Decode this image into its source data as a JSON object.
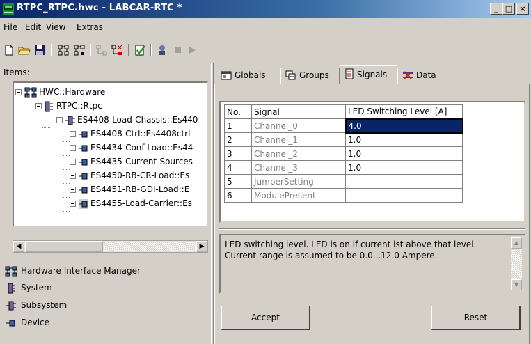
{
  "window": {
    "title": "RTPC_RTPC.hwc - LABCAR-RTC  *"
  },
  "menu": [
    "File",
    "Edit",
    "View",
    "Extras"
  ],
  "toolbar_icons": [
    "new-icon",
    "open-icon",
    "save-icon",
    "tree-a-icon",
    "tree-b-icon",
    "tree-c-icon",
    "tree-d-icon",
    "check-icon",
    "connect-icon",
    "stop-icon",
    "play-icon"
  ],
  "items_label": "Items:",
  "tree": [
    {
      "label": "HWC::Hardware"
    },
    {
      "label": "RTPC::Rtpc"
    },
    {
      "label": "ES4408-Load-Chassis::Es440"
    },
    {
      "label": "ES4408-Ctrl::Es4408ctrl"
    },
    {
      "label": "ES4434-Conf-Load::Es44"
    },
    {
      "label": "ES4435-Current-Sources"
    },
    {
      "label": "ES4450-RB-CR-Load::Es"
    },
    {
      "label": "ES4451-RB-GDI-Load::E"
    },
    {
      "label": "ES4455-Load-Carrier::Es"
    }
  ],
  "legend": [
    {
      "label": "Hardware Interface Manager",
      "icon": "hardware-interface-manager-icon"
    },
    {
      "label": "System",
      "icon": "system-icon"
    },
    {
      "label": "Subsystem",
      "icon": "subsystem-icon"
    },
    {
      "label": "Device",
      "icon": "device-icon"
    }
  ],
  "tabs": [
    {
      "label": "Globals"
    },
    {
      "label": "Groups"
    },
    {
      "label": "Signals",
      "active": true
    },
    {
      "label": "Data"
    }
  ],
  "grid": {
    "headers": {
      "no": "No.",
      "signal": "Signal",
      "level": "LED Switching Level [A]"
    },
    "rows": [
      {
        "no": "1",
        "signal": "Channel_0",
        "value": "4.0"
      },
      {
        "no": "2",
        "signal": "Channel_1",
        "value": "1.0"
      },
      {
        "no": "3",
        "signal": "Channel_2",
        "value": "1.0"
      },
      {
        "no": "4",
        "signal": "Channel_3",
        "value": "1.0"
      },
      {
        "no": "5",
        "signal": "JumperSetting",
        "value": "---"
      },
      {
        "no": "6",
        "signal": "ModulePresent",
        "value": "---"
      }
    ]
  },
  "description": "LED switching level. LED is on if current ist above that level. Current range is assumed to be 0.0...12.0 Ampere.",
  "buttons": {
    "accept": "Accept",
    "reset": "Reset"
  },
  "colors": {
    "titlebar": "#0a246a",
    "selection": "#0a246a",
    "face": "#d4d0c8"
  }
}
